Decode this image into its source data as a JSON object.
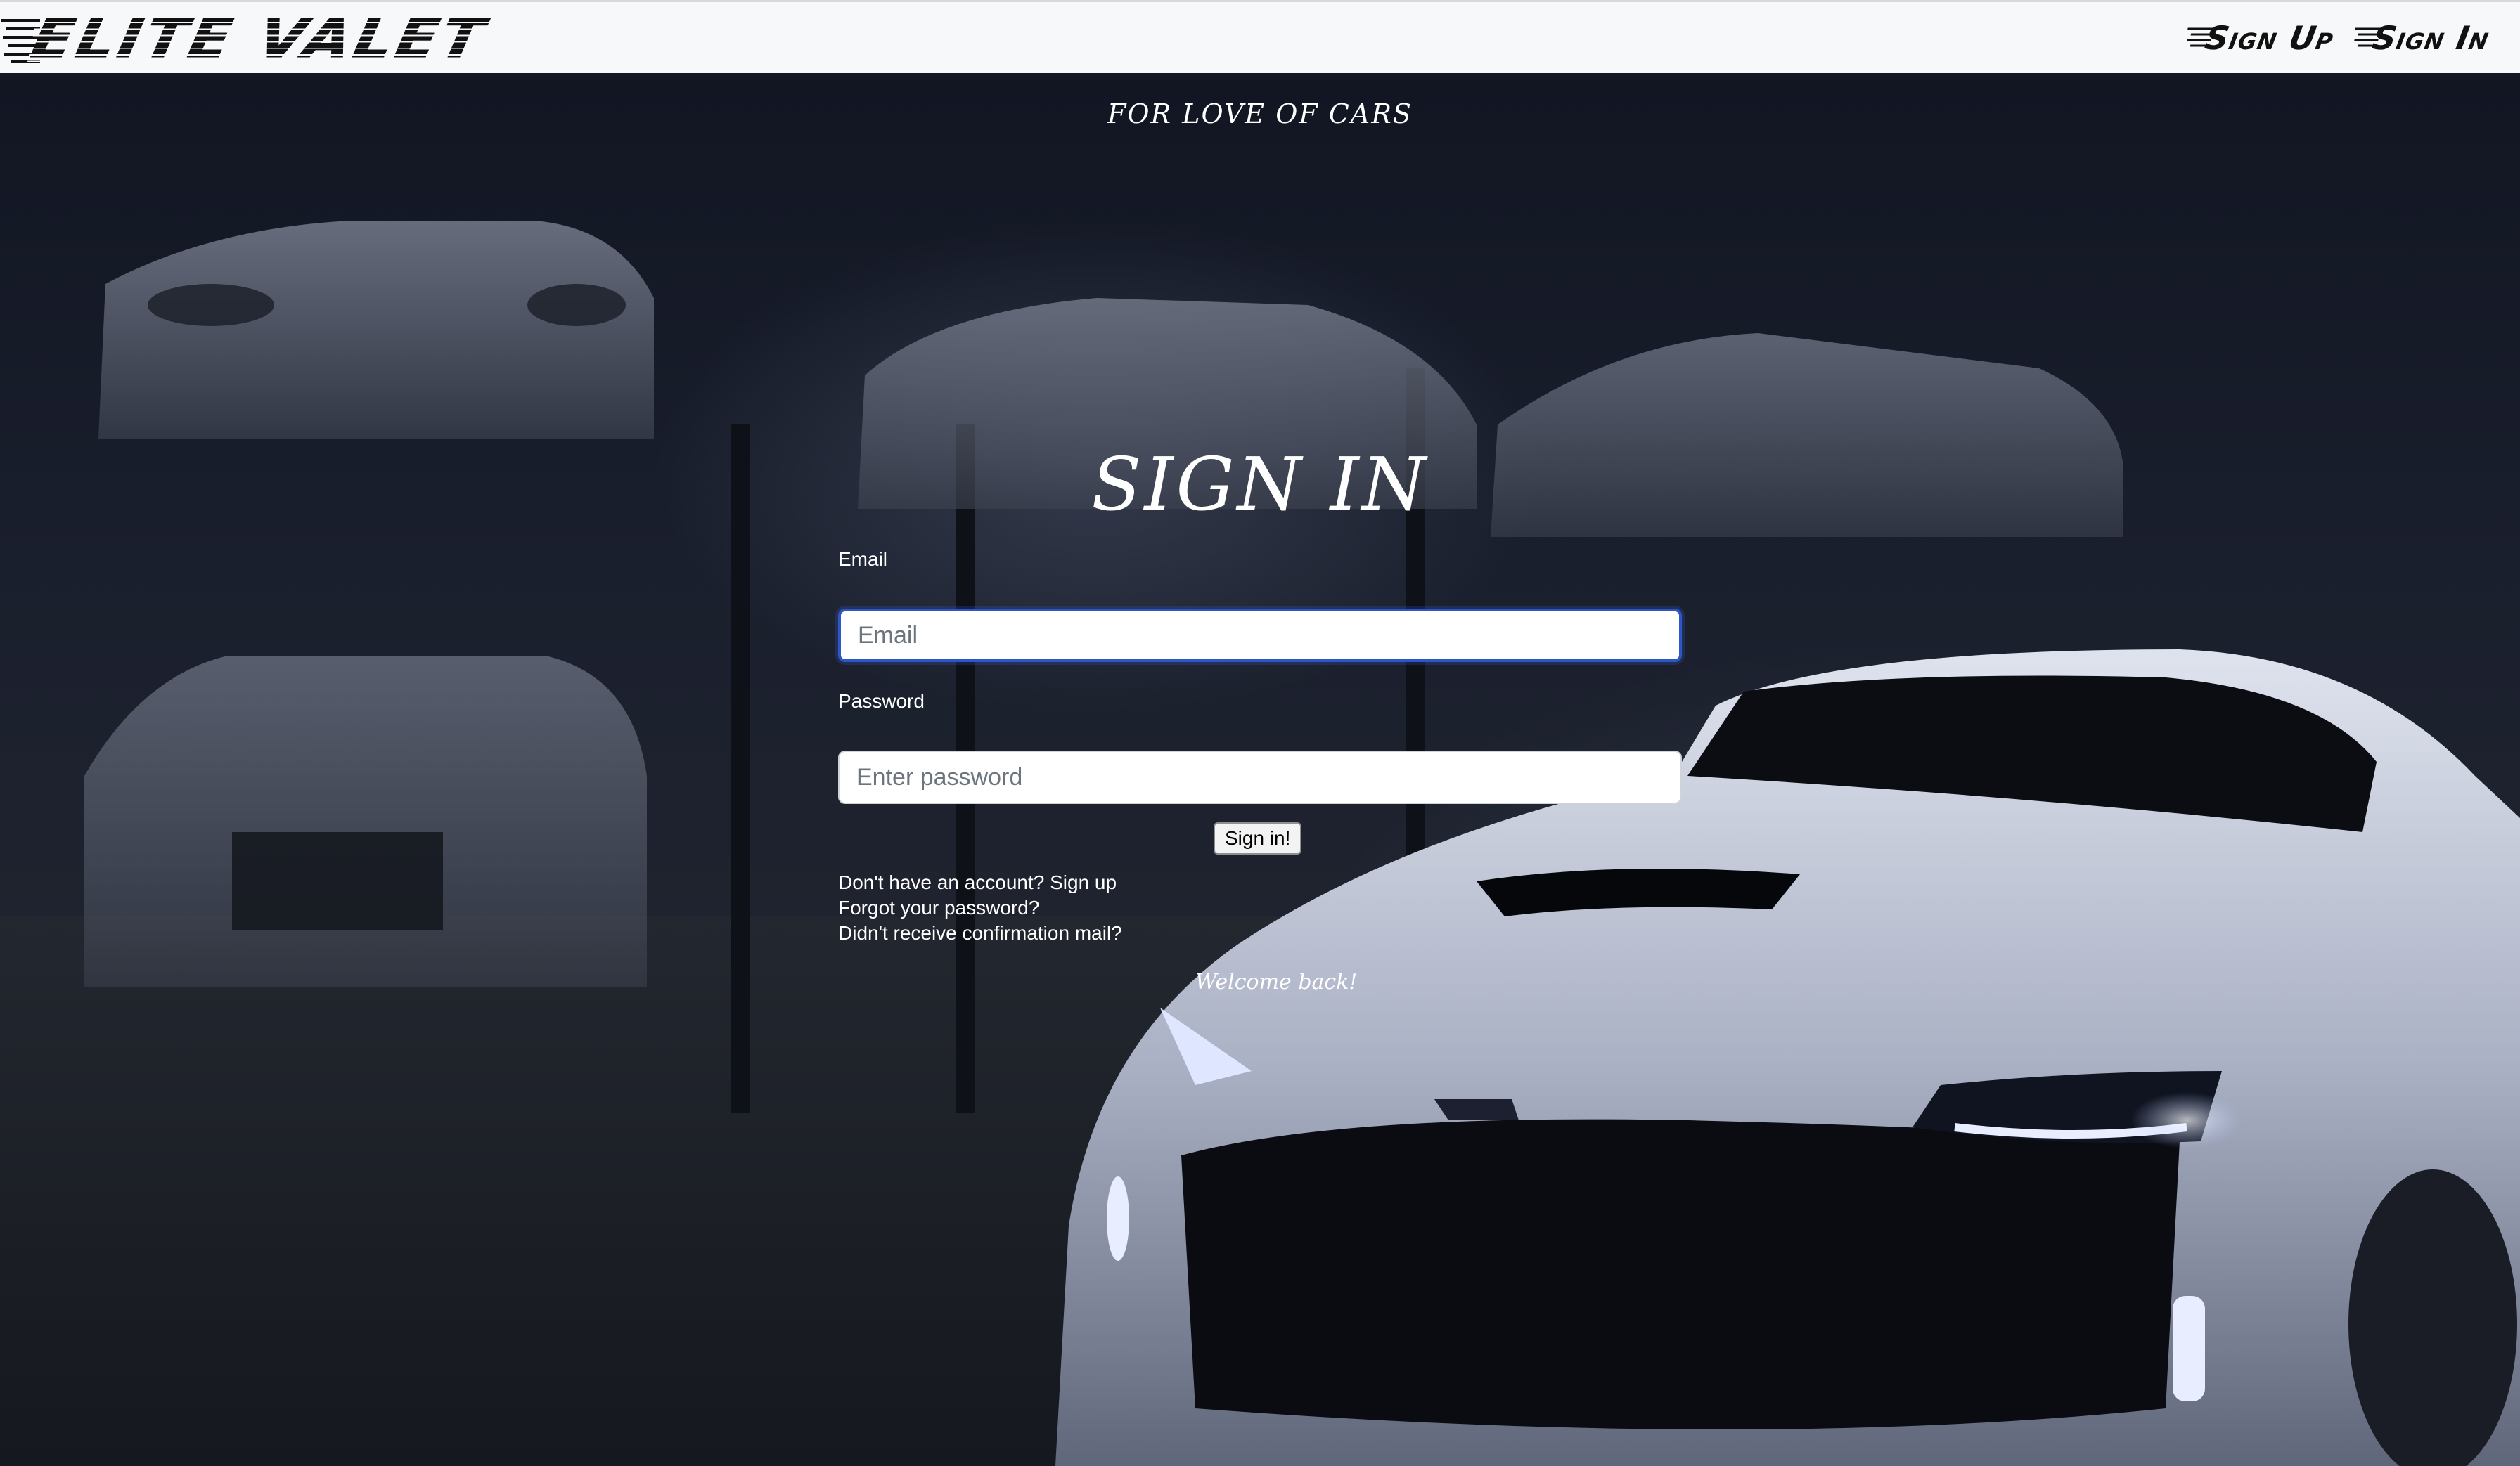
{
  "navbar": {
    "brand": "ELITE VALET",
    "links": [
      {
        "label": "Sign Up"
      },
      {
        "label": "Sign In"
      }
    ]
  },
  "hero": {
    "tagline": "FOR LOVE OF CARS",
    "title": "SIGN IN"
  },
  "form": {
    "email_label": "Email",
    "email_placeholder": "Email",
    "email_value": "",
    "password_label": "Password",
    "password_placeholder": "Enter password",
    "password_value": "",
    "submit_label": "Sign in!"
  },
  "links": {
    "signup": "Don't have an account? Sign up",
    "forgot": "Forgot your password?",
    "confirmation": "Didn't receive confirmation mail?"
  },
  "flash": "Welcome back!",
  "colors": {
    "navbar_bg": "#f7f8fa",
    "focus_border": "#2f56c9",
    "text_light": "#ffffff"
  }
}
